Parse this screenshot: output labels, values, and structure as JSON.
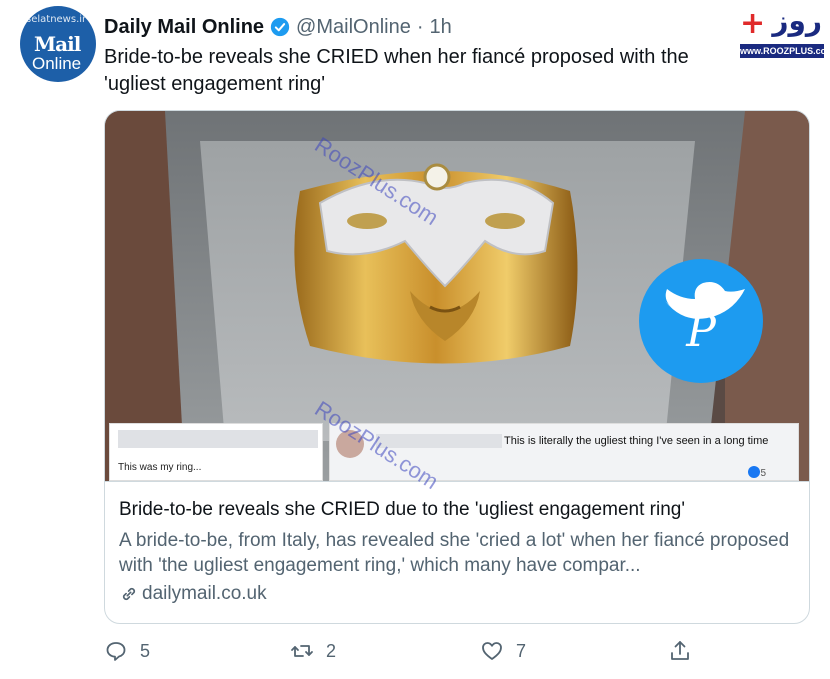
{
  "author": {
    "avatar_watermark": "selatnews.ir",
    "avatar_mail": "Mail",
    "avatar_online": "Online",
    "name": "Daily Mail Online",
    "handle": "@MailOnline",
    "separator": "·",
    "time": "1h"
  },
  "tweet": {
    "text": "Bride-to-be reveals she CRIED when her fiancé proposed with the 'ugliest engagement ring'"
  },
  "site_logo": {
    "plus": "+",
    "name": "روز",
    "url": "www.ROOZPLUS.com"
  },
  "card": {
    "inset_left_caption": "This was my ring...",
    "inset_right_comment": "This is literally the ugliest thing I've seen in a long time",
    "inset_right_reactions": "5",
    "twitter_badge_letter": "P",
    "link_title": "Bride-to-be reveals she CRIED due to the 'ugliest engagement ring'",
    "link_description": "A bride-to-be, from Italy, has revealed she 'cried a lot' when her fiancé proposed with 'the ugliest engagement ring,' which many have compar...",
    "link_domain": "dailymail.co.uk"
  },
  "watermarks": [
    "RoozPlus.com",
    "RoozPlus.com"
  ],
  "actions": {
    "replies": "5",
    "retweets": "2",
    "likes": "7"
  },
  "colors": {
    "verified": "#1d9bf0",
    "secondary_text": "#536471",
    "avatar_bg": "#1d5fa8",
    "twitter_badge": "#1d9bf0",
    "ring_gold": "#d4a53a",
    "ring_silver": "#e8e8ea",
    "box_grey": "#8e9294"
  }
}
